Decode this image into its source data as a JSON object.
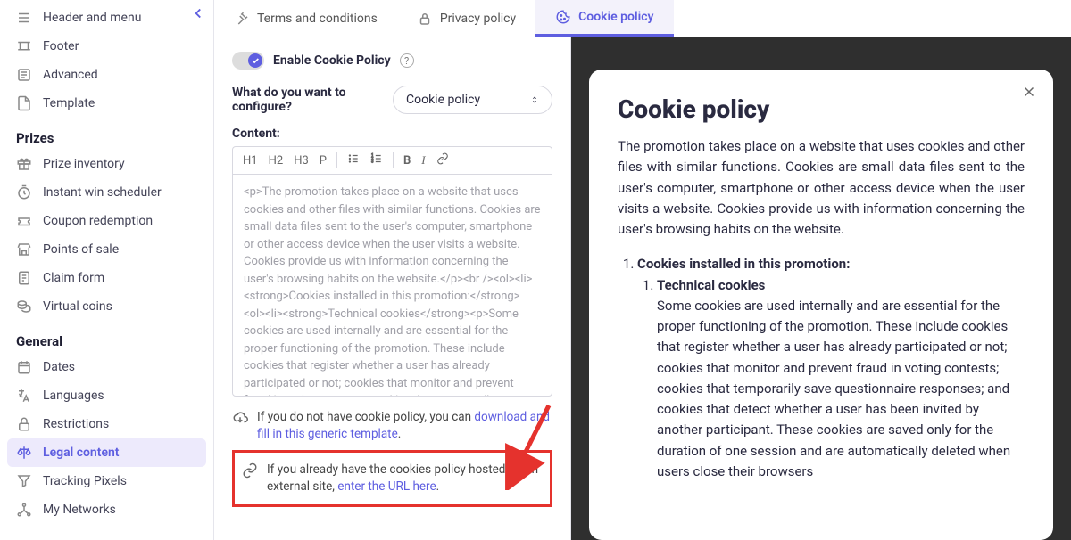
{
  "sidebar": {
    "items_top": [
      {
        "name": "header-menu",
        "label": "Header and menu"
      },
      {
        "name": "footer",
        "label": "Footer"
      },
      {
        "name": "advanced",
        "label": "Advanced"
      },
      {
        "name": "template",
        "label": "Template"
      }
    ],
    "section_prizes": "Prizes",
    "items_prizes": [
      {
        "name": "prize-inventory",
        "label": "Prize inventory"
      },
      {
        "name": "instant-win",
        "label": "Instant win scheduler"
      },
      {
        "name": "coupon-redemption",
        "label": "Coupon redemption"
      },
      {
        "name": "points-of-sale",
        "label": "Points of sale"
      },
      {
        "name": "claim-form",
        "label": "Claim form"
      },
      {
        "name": "virtual-coins",
        "label": "Virtual coins"
      }
    ],
    "section_general": "General",
    "items_general": [
      {
        "name": "dates",
        "label": "Dates"
      },
      {
        "name": "languages",
        "label": "Languages"
      },
      {
        "name": "restrictions",
        "label": "Restrictions"
      },
      {
        "name": "legal-content",
        "label": "Legal content",
        "active": true
      },
      {
        "name": "tracking-pixels",
        "label": "Tracking Pixels"
      },
      {
        "name": "my-networks",
        "label": "My Networks"
      }
    ]
  },
  "tabs": [
    {
      "name": "terms",
      "label": "Terms and conditions"
    },
    {
      "name": "privacy",
      "label": "Privacy policy"
    },
    {
      "name": "cookie",
      "label": "Cookie policy",
      "active": true
    }
  ],
  "form": {
    "toggle_label": "Enable Cookie Policy",
    "configure_label": "What do you want to configure?",
    "configure_value": "Cookie policy",
    "content_label": "Content:",
    "editor_buttons": [
      "H1",
      "H2",
      "H3",
      "P",
      "list-ul",
      "list-ol",
      "B",
      "I",
      "link"
    ],
    "editor_content": "<p>The promotion takes place on a website that uses cookies and other files with similar functions. Cookies are small data files sent to the user's computer, smartphone or other access device when the user visits a website. Cookies provide us with information concerning the user's browsing habits on the website.</p><br /><ol><li><strong>Cookies installed in this promotion:</strong><ol><li><strong>Technical cookies</strong><p>Some cookies are used internally and are essential for the proper functioning of the promotion. These include cookies that register whether a user has already participated or not; cookies that monitor and prevent fraud in voting contests; cookies that temporarily save questionnaire responses; and cookies that detect whether",
    "hint1_pre": "If you do not have cookie policy, you can ",
    "hint1_link": "download and fill in this generic template",
    "hint1_post": ".",
    "hint2_pre": "If you already have the cookies policy hosted on an external site, ",
    "hint2_link": "enter the URL here",
    "hint2_post": "."
  },
  "preview": {
    "title": "Cookie policy",
    "intro": "The promotion takes place on a website that uses cookies and other files with similar functions. Cookies are small data files sent to the user's computer, smartphone or other access device when the user visits a website. Cookies provide us with information concerning the user's browsing habits on the website.",
    "list1": "Cookies installed in this promotion:",
    "list1_1": "Technical cookies",
    "list1_1_body": "Some cookies are used internally and are essential for the proper functioning of the promotion. These include cookies that register whether a user has already participated or not; cookies that monitor and prevent fraud in voting contests; cookies that temporarily save questionnaire responses; and cookies that detect whether a user has been invited by another participant. These cookies are saved only for the duration of one session and are automatically deleted when users close their browsers"
  }
}
